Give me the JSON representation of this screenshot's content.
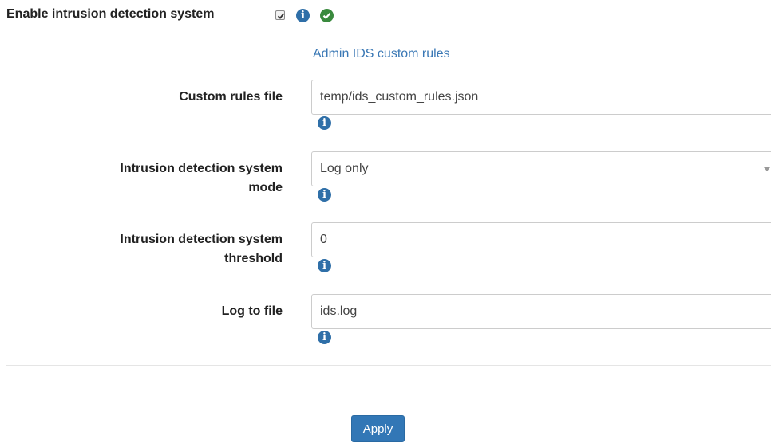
{
  "enable": {
    "label": "Enable intrusion detection system",
    "checked": true,
    "info_icon": "info-icon",
    "status_icon": "check-circle-icon"
  },
  "admin_link": "Admin IDS custom rules",
  "fields": [
    {
      "label": "Custom rules file",
      "value": "temp/ids_custom_rules.json",
      "type": "text",
      "info_icon": "info-icon"
    },
    {
      "label_line1": "Intrusion detection system",
      "label_line2": "mode",
      "value": "Log only",
      "type": "select",
      "info_icon": "info-icon"
    },
    {
      "label_line1": "Intrusion detection system",
      "label_line2": "threshold",
      "value": "0",
      "type": "text",
      "info_icon": "info-icon"
    },
    {
      "label": "Log to file",
      "value": "ids.log",
      "type": "text",
      "info_icon": "info-icon"
    }
  ],
  "apply_label": "Apply",
  "colors": {
    "accent": "#3277b6",
    "link": "#3a78b5",
    "success": "#3a8a3e",
    "info": "#2f6fa8"
  }
}
